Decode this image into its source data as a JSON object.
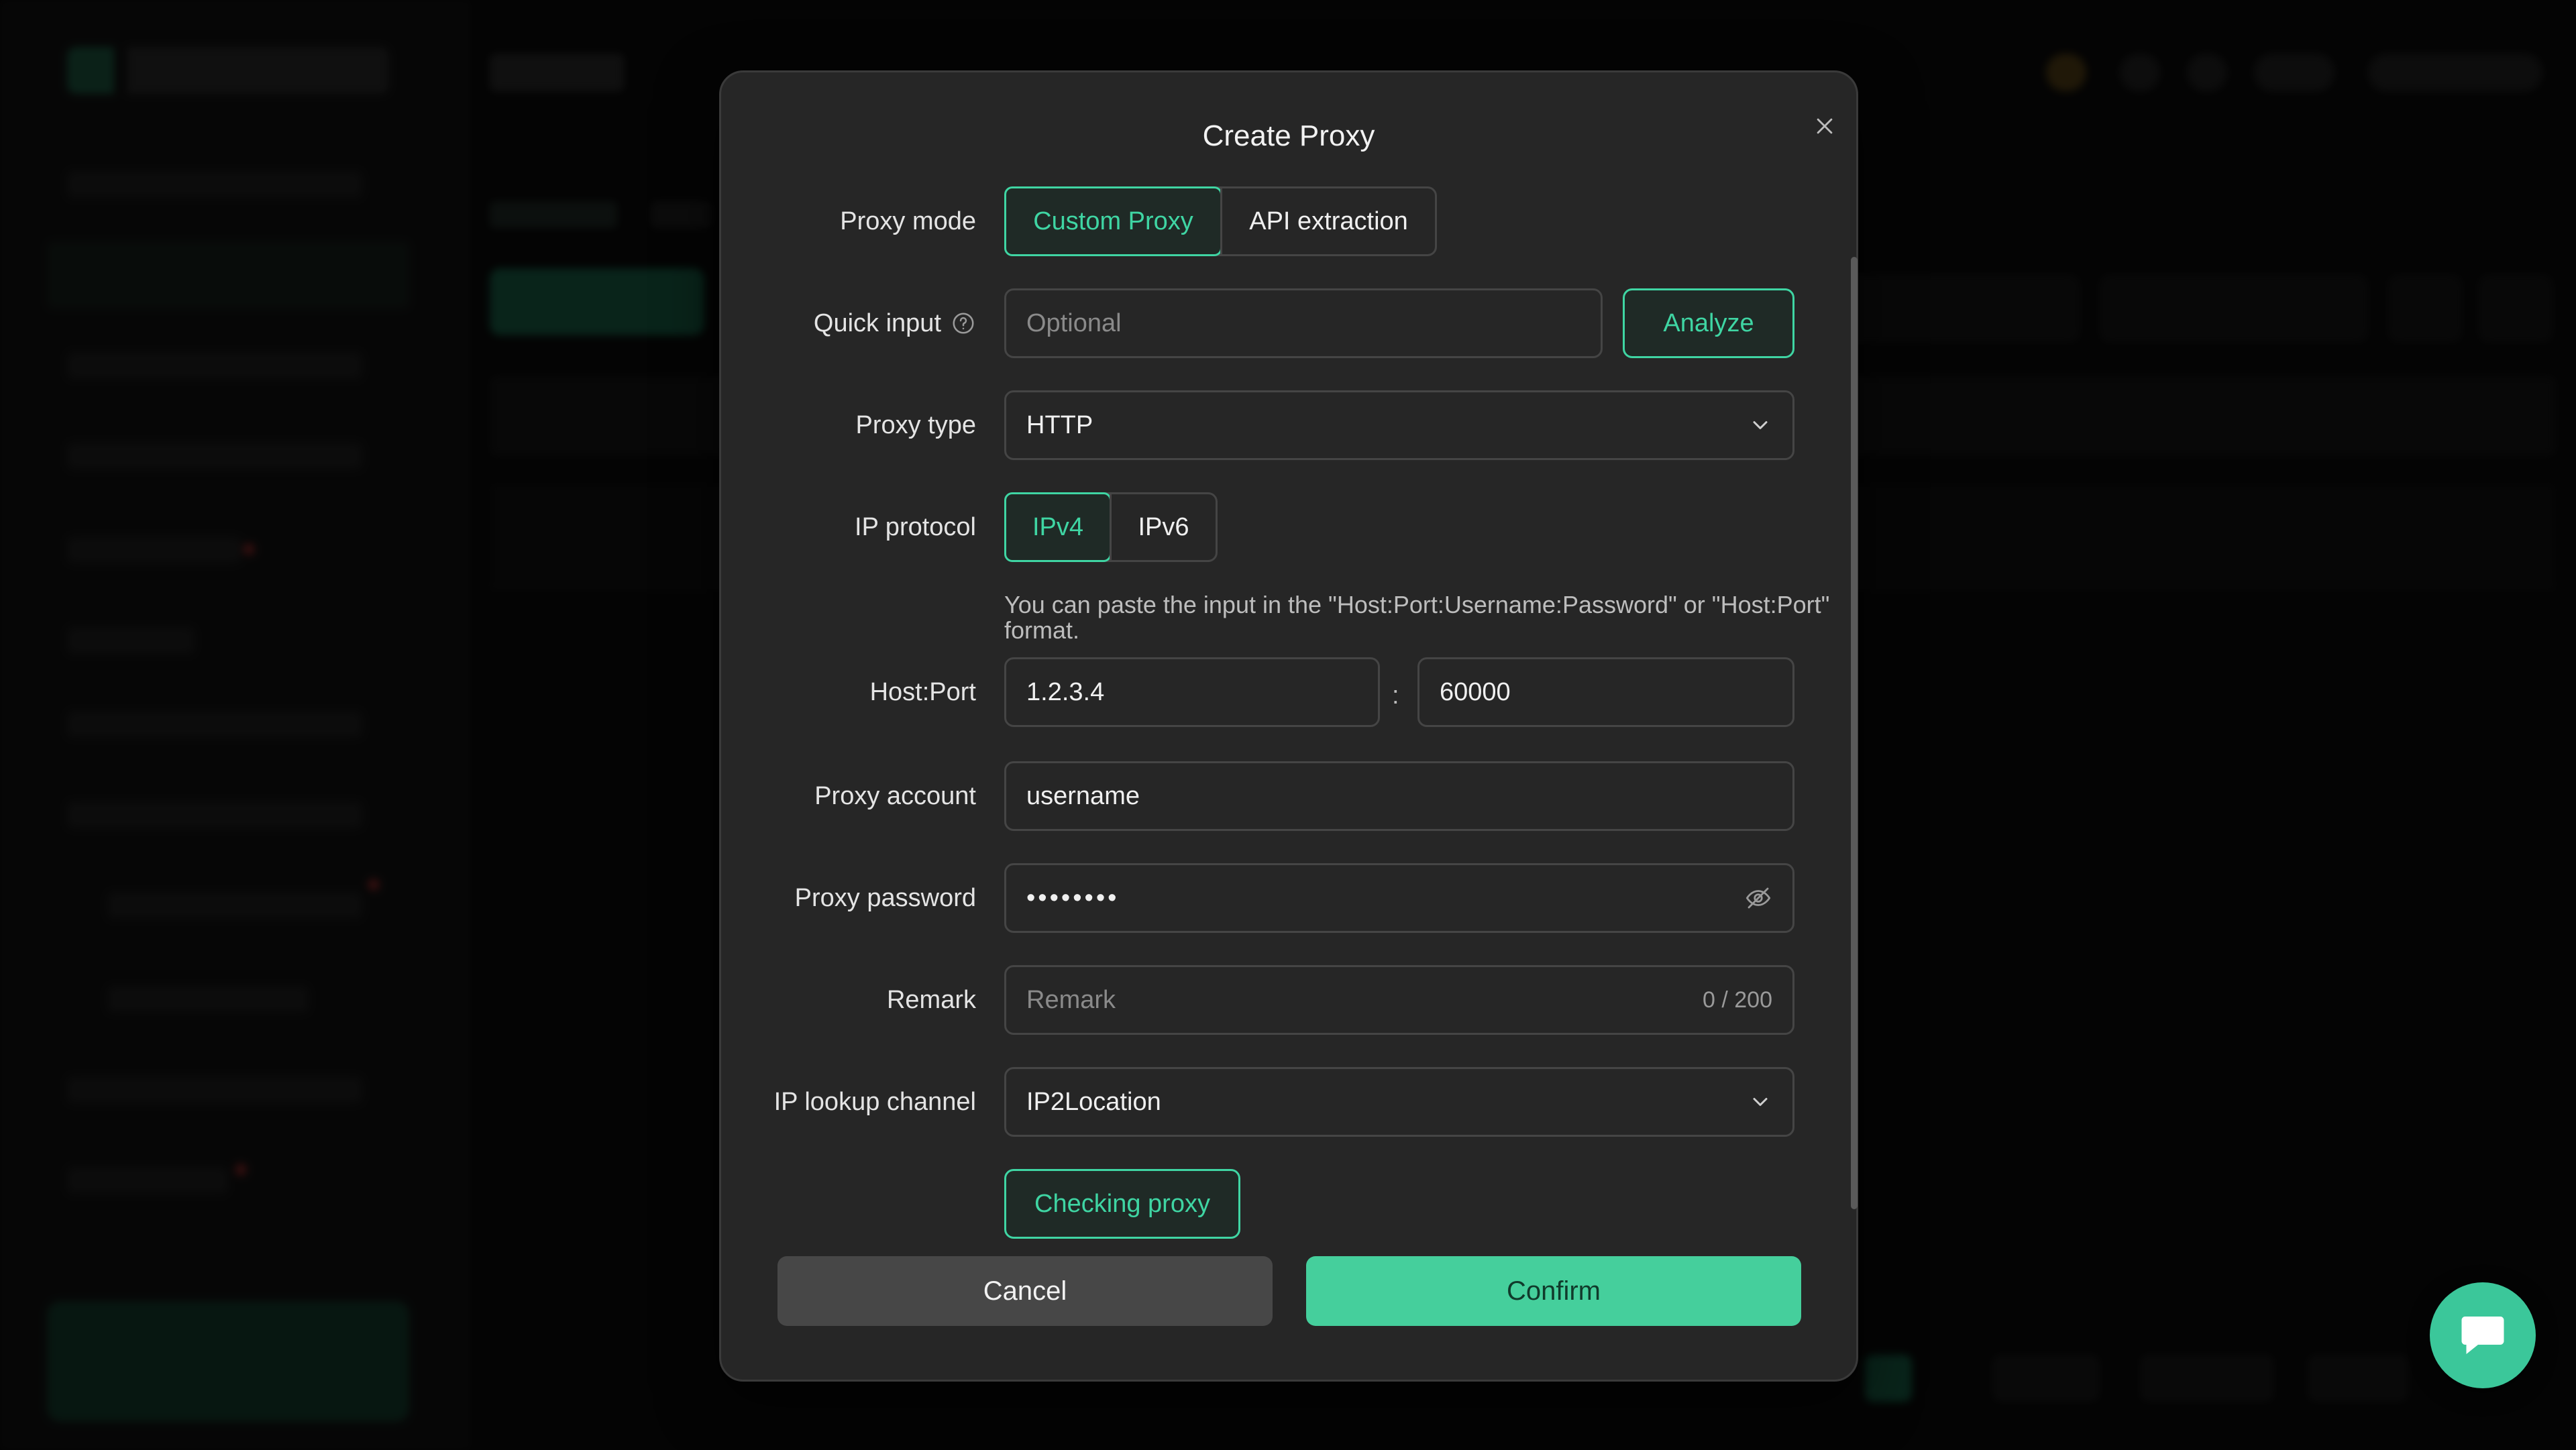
{
  "dialog": {
    "title": "Create Proxy",
    "proxy_mode": {
      "label": "Proxy mode",
      "options": [
        "Custom Proxy",
        "API extraction"
      ],
      "selected": "Custom Proxy"
    },
    "quick_input": {
      "label": "Quick input",
      "value": "",
      "placeholder": "Optional",
      "analyze_label": "Analyze"
    },
    "proxy_type": {
      "label": "Proxy type",
      "value": "HTTP"
    },
    "ip_protocol": {
      "label": "IP protocol",
      "options": [
        "IPv4",
        "IPv6"
      ],
      "selected": "IPv4"
    },
    "host_hint": "You can paste the input in the \"Host:Port:Username:Password\" or \"Host:Port\" format.",
    "host_port": {
      "label": "Host:Port",
      "host": "1.2.3.4",
      "separator": ":",
      "port": "60000"
    },
    "proxy_account": {
      "label": "Proxy account",
      "value": "username"
    },
    "proxy_password": {
      "label": "Proxy password",
      "masked_value": "••••••••"
    },
    "remark": {
      "label": "Remark",
      "placeholder": "Remark",
      "counter": "0 / 200"
    },
    "ip_lookup": {
      "label": "IP lookup channel",
      "value": "IP2Location"
    },
    "check_label": "Checking proxy",
    "cancel_label": "Cancel",
    "confirm_label": "Confirm"
  },
  "colors": {
    "accent": "#3fd5a3",
    "confirm_bg": "#45cf9c",
    "dialog_bg": "#262626",
    "border": "#454545"
  },
  "icons": {
    "close": "close-icon",
    "help": "question-circle-icon",
    "dropdown": "chevron-down-icon",
    "password_toggle": "eye-off-icon",
    "chat": "chat-bubble-icon"
  }
}
